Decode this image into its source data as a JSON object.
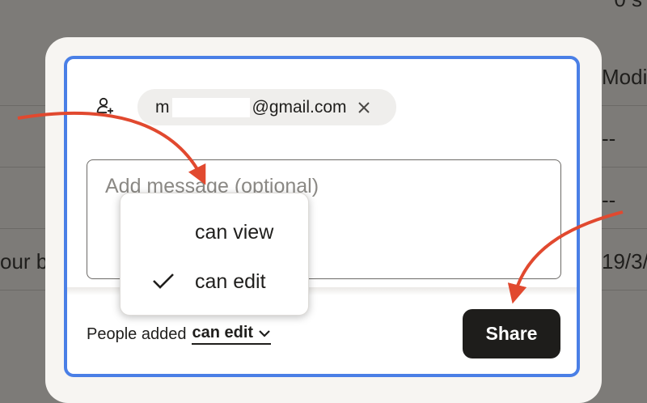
{
  "background": {
    "top_right_text": "0 s",
    "col_header_right": "Modi",
    "row_values_right": [
      "--",
      "--",
      "19/3/"
    ],
    "row_text_left": "our b"
  },
  "share_dialog": {
    "recipient_chip": {
      "email_prefix": "m",
      "email_suffix": "@gmail.com"
    },
    "message": {
      "placeholder": "Add message (optional)"
    },
    "permission": {
      "prefix": "People added",
      "selected": "can edit"
    },
    "share_label": "Share",
    "permission_menu": {
      "items": [
        {
          "label": "can view",
          "checked": false
        },
        {
          "label": "can edit",
          "checked": true
        }
      ]
    }
  },
  "colors": {
    "focus_ring": "#4a7fe6",
    "annotation_arrow": "#e1492f",
    "share_button": "#1e1d1b"
  }
}
